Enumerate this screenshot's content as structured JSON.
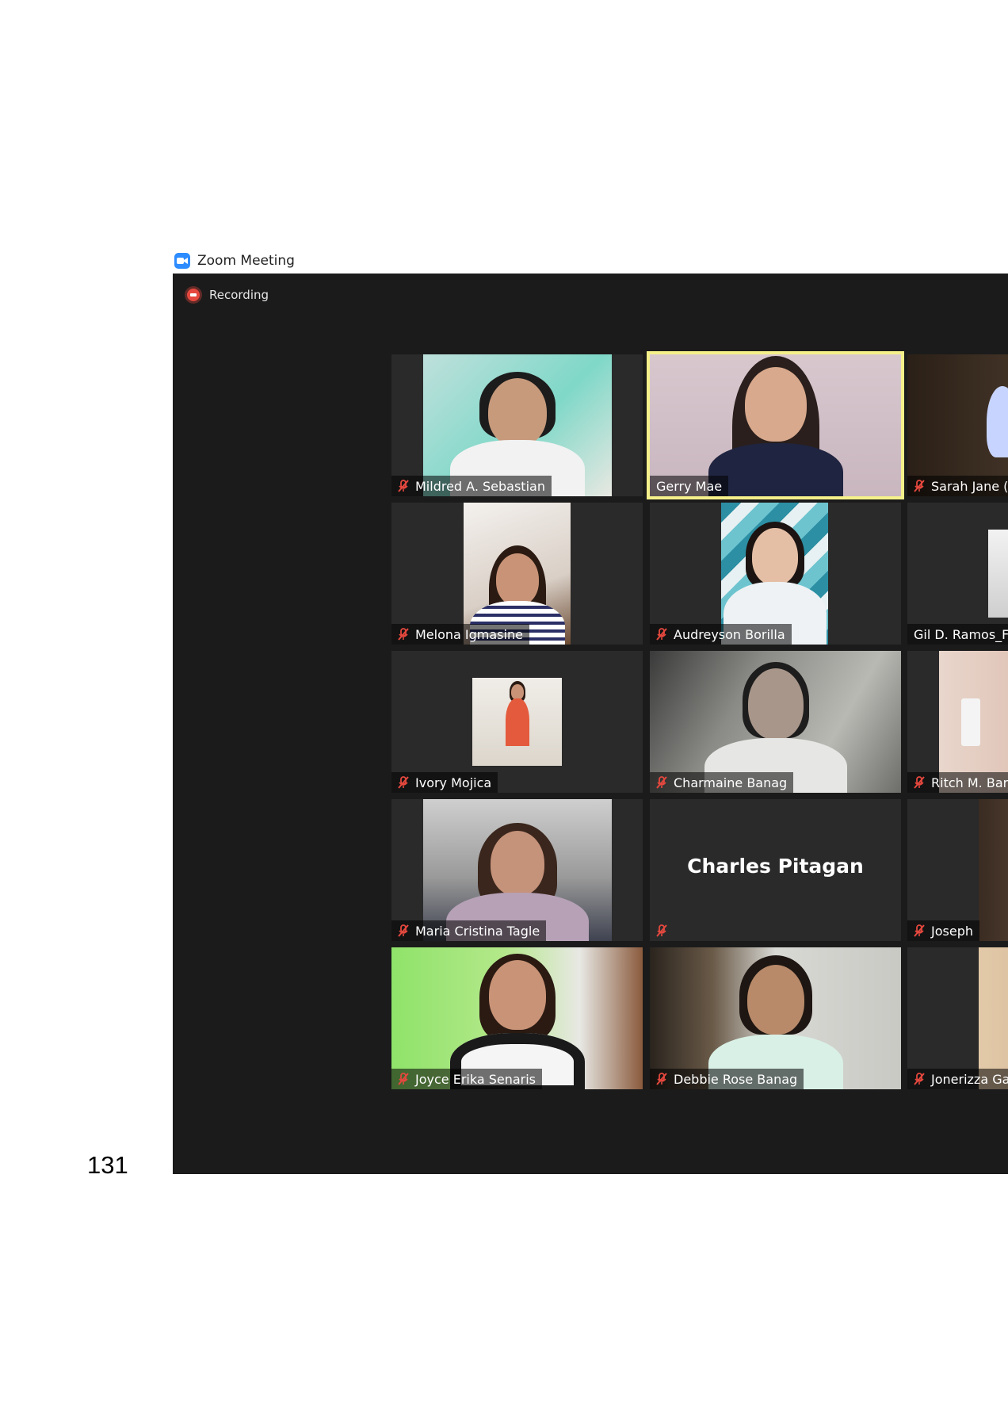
{
  "window": {
    "title": "Zoom Meeting"
  },
  "status": {
    "recording": "Recording"
  },
  "tiles": [
    {
      "name": "Mildred A. Sebastian",
      "muted": true
    },
    {
      "name": "Gerry Mae",
      "muted": false,
      "active": true
    },
    {
      "name": "Sarah Jane (",
      "muted": true
    },
    {
      "name": "Melona Igmasine",
      "muted": true
    },
    {
      "name": "Audreyson Borilla",
      "muted": true
    },
    {
      "name": "Gil D. Ramos_F",
      "muted": false
    },
    {
      "name": "Ivory Mojica",
      "muted": true
    },
    {
      "name": "Charmaine Banag",
      "muted": true
    },
    {
      "name": "Ritch M. Bar",
      "muted": true
    },
    {
      "name": "Maria Cristina Tagle",
      "muted": true
    },
    {
      "name": "",
      "display_name": "Charles Pitagan",
      "muted": true,
      "video_off": true
    },
    {
      "name": "Joseph",
      "muted": true
    },
    {
      "name": "Joyce Erika Senaris",
      "muted": true
    },
    {
      "name": "Debbie Rose Banag",
      "muted": true
    },
    {
      "name": "Jonerizza Ga",
      "muted": true
    }
  ],
  "page": {
    "number": "131"
  },
  "colors": {
    "active_speaker": "#f5f08a",
    "muted_icon": "#e5483e",
    "zoom_blue": "#2d8cff"
  }
}
